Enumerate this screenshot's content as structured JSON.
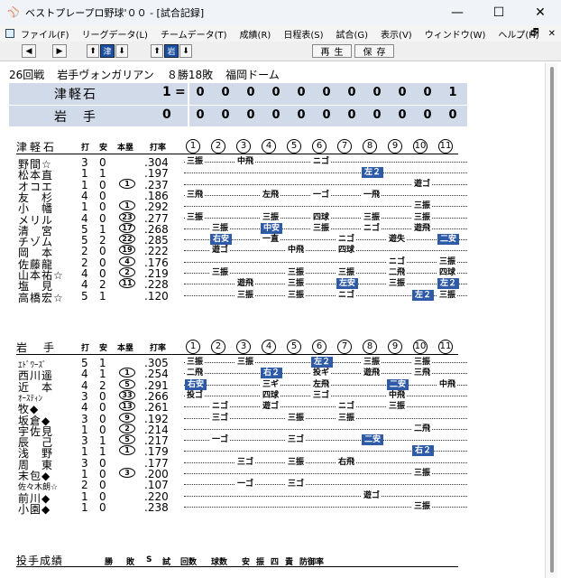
{
  "window": {
    "title": "ベストプレープロ野球'００ - [試合記録]",
    "minimize": "—",
    "maximize": "☐",
    "close": "✕",
    "icon": "baseball-cap-icon"
  },
  "menu": [
    "ファイル(F)",
    "リーグデータ(L)",
    "チームデータ(T)",
    "成績(R)",
    "日程表(S)",
    "試合(G)",
    "表示(V)",
    "ウィンドウ(W)",
    "ヘルプ(H)"
  ],
  "mdi": {
    "minimize": "_",
    "restore": "🗗",
    "close": "✕"
  },
  "toolbar": {
    "left": "◀",
    "right": "▶",
    "up1": "⬆",
    "team1": "津",
    "down1": "⬇",
    "up2": "⬆",
    "team2": "岩",
    "down2": "⬇",
    "play": "再生",
    "save": "保存"
  },
  "header": {
    "round": "26回戦",
    "opponent": "岩手ヴォンガリアン",
    "record": "８勝18敗",
    "park": "福岡ドーム"
  },
  "scoreboard": [
    {
      "team": "津軽石",
      "total": "1",
      "innings": [
        "0",
        "0",
        "0",
        "0",
        "0",
        "0",
        "0",
        "0",
        "0",
        "0",
        "1"
      ]
    },
    {
      "team": "岩　手",
      "total": "0",
      "innings": [
        "0",
        "0",
        "0",
        "0",
        "0",
        "0",
        "0",
        "0",
        "0",
        "0",
        "0"
      ]
    }
  ],
  "columns": {
    "ab": "打",
    "h": "安",
    "hr": "本塁",
    "avg": "打率",
    "innings": [
      "1",
      "2",
      "3",
      "4",
      "5",
      "6",
      "7",
      "8",
      "9",
      "10",
      "11"
    ]
  },
  "team1": {
    "name": "津軽石",
    "players": [
      {
        "name": "野間☆",
        "ab": "3",
        "h": "0",
        "hr": "",
        "avg": ".304",
        "res": [
          [
            "1",
            "三振",
            0
          ],
          [
            "3",
            "中飛",
            0
          ],
          [
            "6",
            "ニゴ",
            0
          ]
        ]
      },
      {
        "name": "松本直",
        "ab": "1",
        "h": "1",
        "hr": "",
        "avg": ".197",
        "res": [
          [
            "8",
            "左２",
            1
          ]
        ]
      },
      {
        "name": "オコエ",
        "ab": "1",
        "h": "0",
        "hr": "1",
        "avg": ".237",
        "res": [
          [
            "10",
            "遊ゴ",
            0
          ]
        ]
      },
      {
        "name": "友　杉",
        "ab": "4",
        "h": "0",
        "hr": "",
        "avg": ".186",
        "res": [
          [
            "1",
            "三飛",
            0
          ],
          [
            "4",
            "左飛",
            0
          ],
          [
            "6",
            "一ゴ",
            0
          ],
          [
            "8",
            "一飛",
            0
          ]
        ]
      },
      {
        "name": "小　幡",
        "ab": "1",
        "h": "0",
        "hr": "1",
        "avg": ".292",
        "res": [
          [
            "10",
            "三振",
            0
          ]
        ]
      },
      {
        "name": "メリル",
        "ab": "4",
        "h": "0",
        "hr": "23",
        "avg": ".277",
        "res": [
          [
            "1",
            "三振",
            0
          ],
          [
            "4",
            "三振",
            0
          ],
          [
            "6",
            "四球",
            0
          ],
          [
            "8",
            "三振",
            0
          ],
          [
            "10",
            "三振",
            0
          ]
        ]
      },
      {
        "name": "清　宮",
        "ab": "5",
        "h": "1",
        "hr": "17",
        "avg": ".268",
        "res": [
          [
            "2",
            "三振",
            0
          ],
          [
            "4",
            "中安",
            1
          ],
          [
            "6",
            "三振",
            0
          ],
          [
            "8",
            "ニゴ",
            0
          ],
          [
            "10",
            "遊飛",
            0
          ]
        ]
      },
      {
        "name": "チゾム",
        "ab": "5",
        "h": "2",
        "hr": "22",
        "avg": ".285",
        "res": [
          [
            "2",
            "右安",
            1
          ],
          [
            "4",
            "一直",
            0
          ],
          [
            "7",
            "ニゴ",
            0
          ],
          [
            "9",
            "遊失",
            0
          ],
          [
            "11",
            "二安",
            1
          ]
        ]
      },
      {
        "name": "岡　本",
        "ab": "2",
        "h": "0",
        "hr": "19",
        "avg": ".222",
        "res": [
          [
            "2",
            "遊ゴ",
            0
          ],
          [
            "5",
            "中飛",
            0
          ],
          [
            "7",
            "四球",
            0
          ]
        ]
      },
      {
        "name": "佐藤龍",
        "ab": "2",
        "h": "0",
        "hr": "4",
        "avg": ".176",
        "res": [
          [
            "9",
            "ニゴ",
            0
          ],
          [
            "11",
            "三振",
            0
          ]
        ]
      },
      {
        "name": "山本祐☆",
        "ab": "4",
        "h": "0",
        "hr": "2",
        "avg": ".219",
        "res": [
          [
            "2",
            "三振",
            0
          ],
          [
            "5",
            "三振",
            0
          ],
          [
            "7",
            "三振",
            0
          ],
          [
            "9",
            "二飛",
            0
          ],
          [
            "11",
            "四球",
            0
          ]
        ]
      },
      {
        "name": "塩　見",
        "ab": "4",
        "h": "2",
        "hr": "11",
        "avg": ".228",
        "res": [
          [
            "3",
            "遊飛",
            0
          ],
          [
            "5",
            "三振",
            0
          ],
          [
            "7",
            "左安",
            1
          ],
          [
            "9",
            "三振",
            0
          ],
          [
            "11",
            "左２",
            1
          ]
        ]
      },
      {
        "name": "高橋宏☆",
        "ab": "5",
        "h": "1",
        "hr": "",
        "avg": ".120",
        "res": [
          [
            "3",
            "三振",
            0
          ],
          [
            "5",
            "三振",
            0
          ],
          [
            "7",
            "ニゴ",
            0
          ],
          [
            "10",
            "左２",
            1
          ],
          [
            "11",
            "三振",
            0
          ]
        ]
      }
    ]
  },
  "team2": {
    "name": "岩　手",
    "players": [
      {
        "name": "ｴﾄﾞﾜｰｽﾞ",
        "ab": "5",
        "h": "1",
        "hr": "",
        "avg": ".305",
        "res": [
          [
            "1",
            "三振",
            0
          ],
          [
            "3",
            "三振",
            0
          ],
          [
            "6",
            "左２",
            1
          ],
          [
            "8",
            "三振",
            0
          ],
          [
            "10",
            "三振",
            0
          ]
        ]
      },
      {
        "name": "西川遥",
        "ab": "4",
        "h": "1",
        "hr": "1",
        "avg": ".254",
        "res": [
          [
            "1",
            "二飛",
            0
          ],
          [
            "4",
            "右２",
            1
          ],
          [
            "6",
            "投ギ",
            0
          ],
          [
            "8",
            "遊飛",
            0
          ],
          [
            "10",
            "三飛",
            0
          ]
        ]
      },
      {
        "name": "近　本",
        "ab": "4",
        "h": "2",
        "hr": "5",
        "avg": ".291",
        "res": [
          [
            "1",
            "右安",
            1
          ],
          [
            "4",
            "三ギ",
            0
          ],
          [
            "6",
            "左飛",
            0
          ],
          [
            "9",
            "二安",
            1
          ],
          [
            "11",
            "中飛",
            0
          ]
        ]
      },
      {
        "name": "ｵｰｽﾃｨﾝ",
        "ab": "3",
        "h": "0",
        "hr": "33",
        "avg": ".266",
        "res": [
          [
            "1",
            "投ゴ",
            0
          ],
          [
            "4",
            "四球",
            0
          ],
          [
            "6",
            "三ゴ",
            0
          ],
          [
            "9",
            "中飛",
            0
          ]
        ]
      },
      {
        "name": "牧◆",
        "ab": "4",
        "h": "0",
        "hr": "13",
        "avg": ".261",
        "res": [
          [
            "2",
            "ニゴ",
            0
          ],
          [
            "4",
            "遊ゴ",
            0
          ],
          [
            "7",
            "ニゴ",
            0
          ],
          [
            "9",
            "三振",
            0
          ]
        ]
      },
      {
        "name": "坂倉◆",
        "ab": "3",
        "h": "0",
        "hr": "9",
        "avg": ".192",
        "res": [
          [
            "2",
            "三ゴ",
            0
          ],
          [
            "5",
            "三振",
            0
          ],
          [
            "7",
            "三振",
            0
          ]
        ]
      },
      {
        "name": "宇佐見",
        "ab": "1",
        "h": "0",
        "hr": "2",
        "avg": ".214",
        "res": [
          [
            "10",
            "二飛",
            0
          ]
        ]
      },
      {
        "name": "辰　己",
        "ab": "3",
        "h": "1",
        "hr": "5",
        "avg": ".217",
        "res": [
          [
            "2",
            "一ゴ",
            0
          ],
          [
            "5",
            "三ゴ",
            0
          ],
          [
            "8",
            "二安",
            1
          ]
        ]
      },
      {
        "name": "浅　野",
        "ab": "1",
        "h": "1",
        "hr": "1",
        "avg": ".179",
        "res": [
          [
            "10",
            "右２",
            1
          ]
        ]
      },
      {
        "name": "周　東",
        "ab": "3",
        "h": "0",
        "hr": "",
        "avg": ".177",
        "res": [
          [
            "3",
            "三ゴ",
            0
          ],
          [
            "5",
            "三振",
            0
          ],
          [
            "7",
            "右飛",
            0
          ]
        ]
      },
      {
        "name": "末包◆",
        "ab": "1",
        "h": "0",
        "hr": "3",
        "avg": ".200",
        "res": [
          [
            "10",
            "三振",
            0
          ]
        ]
      },
      {
        "name": "佐々木朗☆",
        "ab": "2",
        "h": "0",
        "hr": "",
        "avg": ".107",
        "res": [
          [
            "3",
            "一ゴ",
            0
          ],
          [
            "5",
            "三ゴ",
            0
          ]
        ]
      },
      {
        "name": "前川◆",
        "ab": "1",
        "h": "0",
        "hr": "",
        "avg": ".220",
        "res": [
          [
            "8",
            "遊ゴ",
            0
          ]
        ]
      },
      {
        "name": "小園◆",
        "ab": "1",
        "h": "0",
        "hr": "",
        "avg": ".238",
        "res": [
          [
            "10",
            "三振",
            0
          ]
        ]
      }
    ]
  },
  "pitching": {
    "title": "投手成績",
    "cols": [
      "勝",
      "敗",
      "S",
      "試",
      "回数",
      "球数",
      "安",
      "振",
      "四",
      "責",
      "防御率"
    ]
  }
}
